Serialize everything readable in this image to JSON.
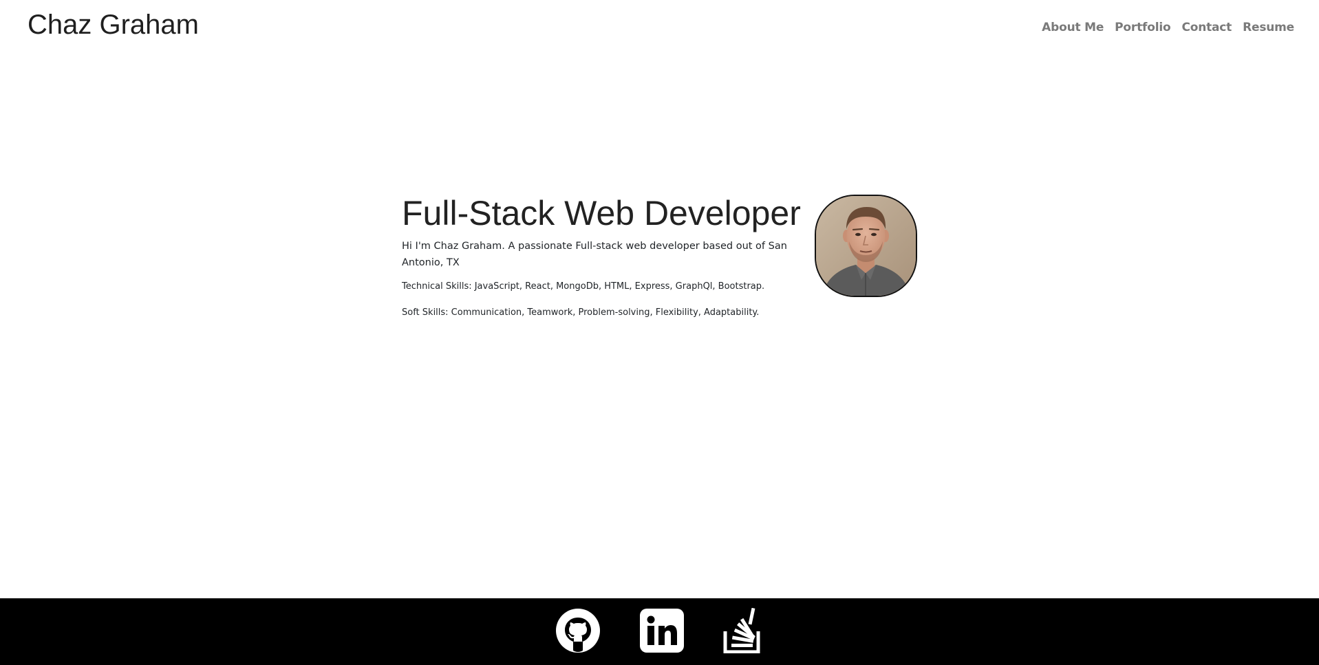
{
  "header": {
    "brand": "Chaz Graham",
    "nav": [
      {
        "label": "About Me"
      },
      {
        "label": "Portfolio"
      },
      {
        "label": "Contact"
      },
      {
        "label": "Resume"
      }
    ]
  },
  "hero": {
    "title": "Full-Stack Web Developer",
    "intro": "Hi I'm Chaz Graham. A passionate Full-stack web developer based out of San Antonio, TX",
    "technical_skills": "Technical Skills: JavaScript, React, MongoDb, HTML, Express, GraphQl, Bootstrap.",
    "soft_skills": "Soft Skills: Communication, Teamwork, Problem-solving, Flexibility, Adaptability."
  },
  "profile_photo": {
    "icon": "avatar-photo"
  },
  "footer": {
    "links": [
      {
        "icon": "github-icon"
      },
      {
        "icon": "linkedin-icon"
      },
      {
        "icon": "stackoverflow-icon"
      }
    ]
  },
  "colors": {
    "nav_text": "#7a7a7a",
    "footer_bg": "#000000",
    "text": "#212529"
  }
}
